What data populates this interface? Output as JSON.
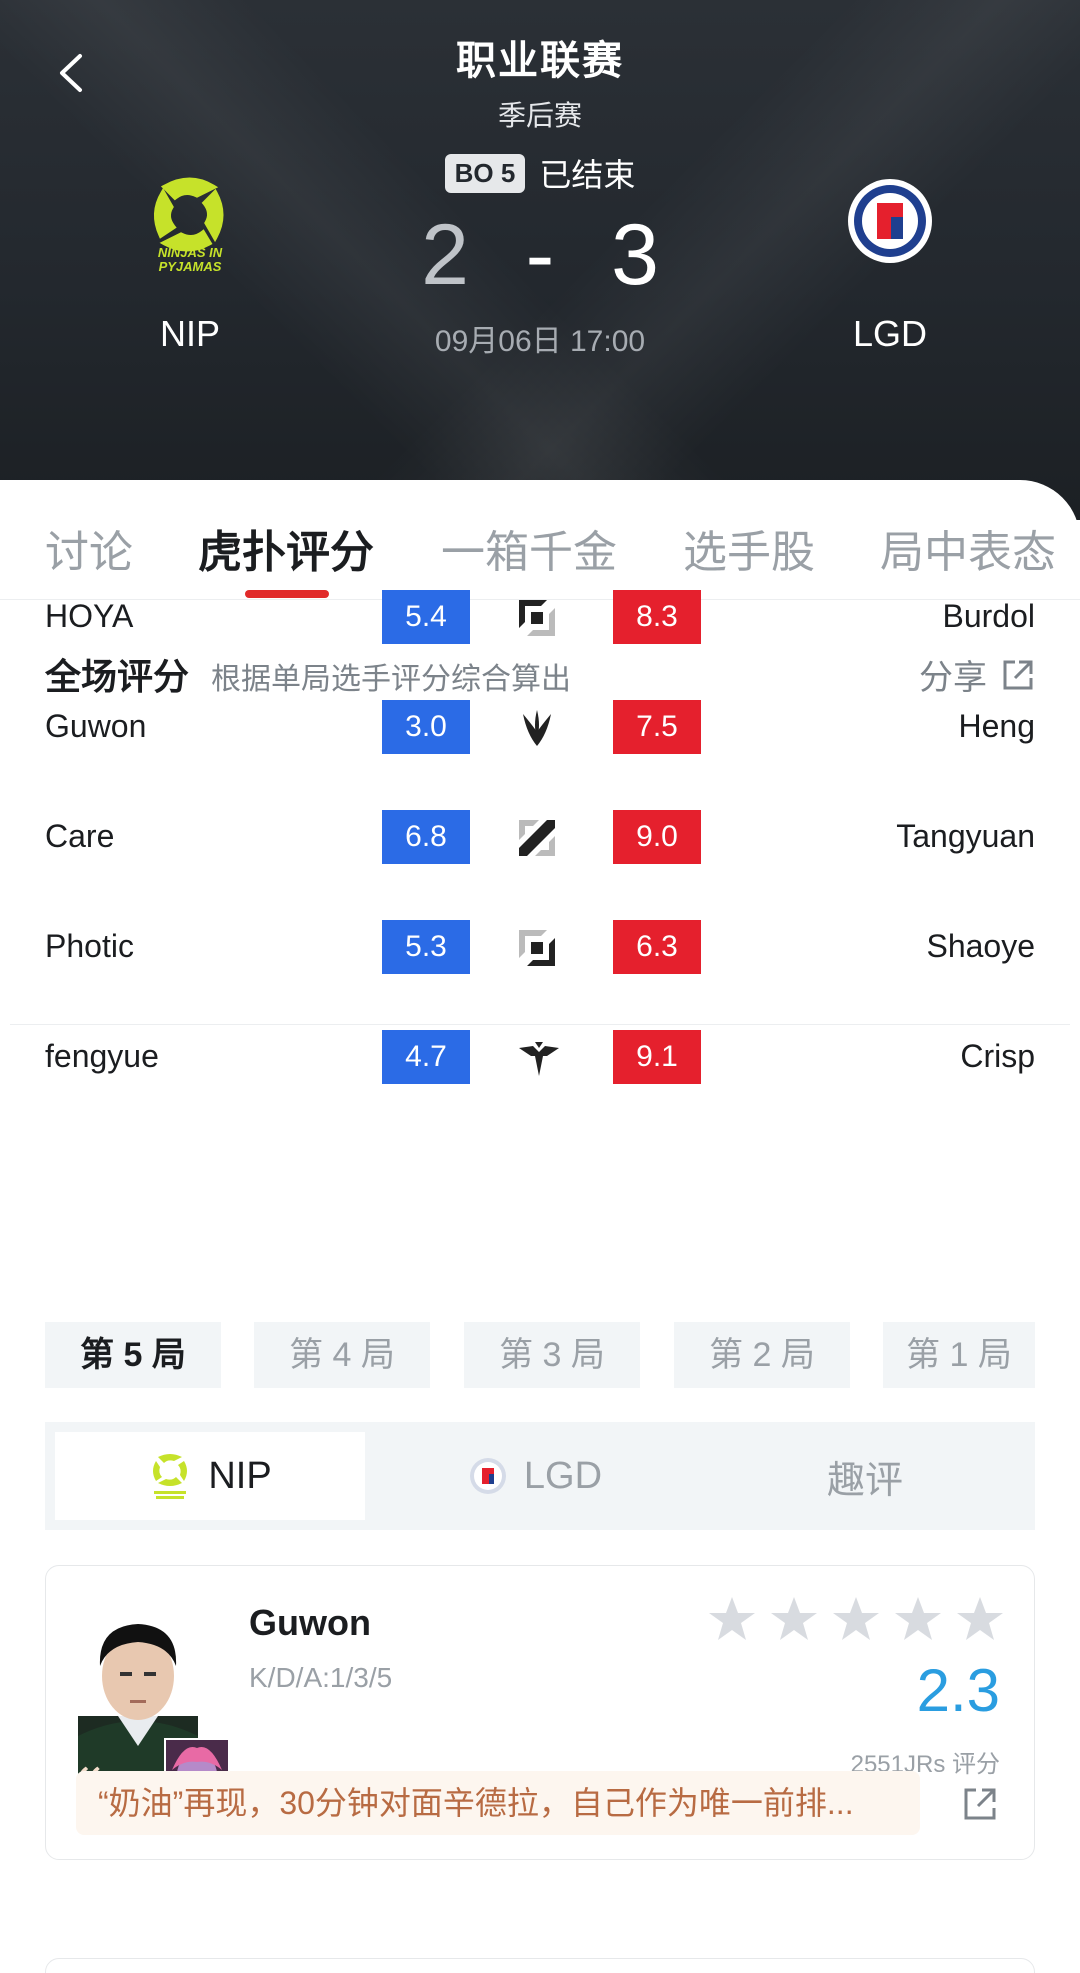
{
  "header": {
    "title": "职业联赛",
    "stage": "季后赛",
    "format": "BO 5",
    "status": "已结束",
    "score_left": "2",
    "score_sep": "-",
    "score_right": "3",
    "time": "09月06日 17:00",
    "team_left": {
      "name": "NIP",
      "logo": "ninjas-in-pyjamas-logo",
      "color": "#c6e22a"
    },
    "team_right": {
      "name": "LGD",
      "logo": "lgd-logo",
      "color": "#1f3f8f"
    }
  },
  "tabs": [
    {
      "label": "讨论"
    },
    {
      "label": "虎扑评分"
    },
    {
      "label": "一箱千金"
    },
    {
      "label": "选手股"
    },
    {
      "label": "局中表态"
    }
  ],
  "rating": {
    "title": "全场评分",
    "subtitle": "根据单局选手评分综合算出",
    "share": "分享",
    "rows": [
      {
        "left": "HOYA",
        "left_score": "5.4",
        "role": "top-icon",
        "right_score": "8.3",
        "right": "Burdol"
      },
      {
        "left": "Guwon",
        "left_score": "3.0",
        "role": "jungle-icon",
        "right_score": "7.5",
        "right": "Heng"
      },
      {
        "left": "Care",
        "left_score": "6.8",
        "role": "mid-icon",
        "right_score": "9.0",
        "right": "Tangyuan"
      },
      {
        "left": "Photic",
        "left_score": "5.3",
        "role": "bottom-icon",
        "right_score": "6.3",
        "right": "Shaoye"
      },
      {
        "left": "fengyue",
        "left_score": "4.7",
        "role": "support-icon",
        "right_score": "9.1",
        "right": "Crisp"
      }
    ]
  },
  "games": [
    {
      "label": "第 5 局"
    },
    {
      "label": "第 4 局"
    },
    {
      "label": "第 3 局"
    },
    {
      "label": "第 2 局"
    },
    {
      "label": "第 1 局"
    }
  ],
  "team_switch": [
    {
      "label": "NIP"
    },
    {
      "label": "LGD"
    },
    {
      "label": "趣评"
    }
  ],
  "player_card": {
    "name": "Guwon",
    "kda": "K/D/A:1/3/5",
    "score": "2.3",
    "count": "2551JRs 评分",
    "stars": 0,
    "comment": "“奶油”再现，30分钟对面辛德拉，自己作为唯一前排..."
  },
  "colors": {
    "blue": "#2b6be6",
    "red": "#e5202d",
    "accent": "#e12a2a",
    "score_blue": "#2a9de0"
  }
}
